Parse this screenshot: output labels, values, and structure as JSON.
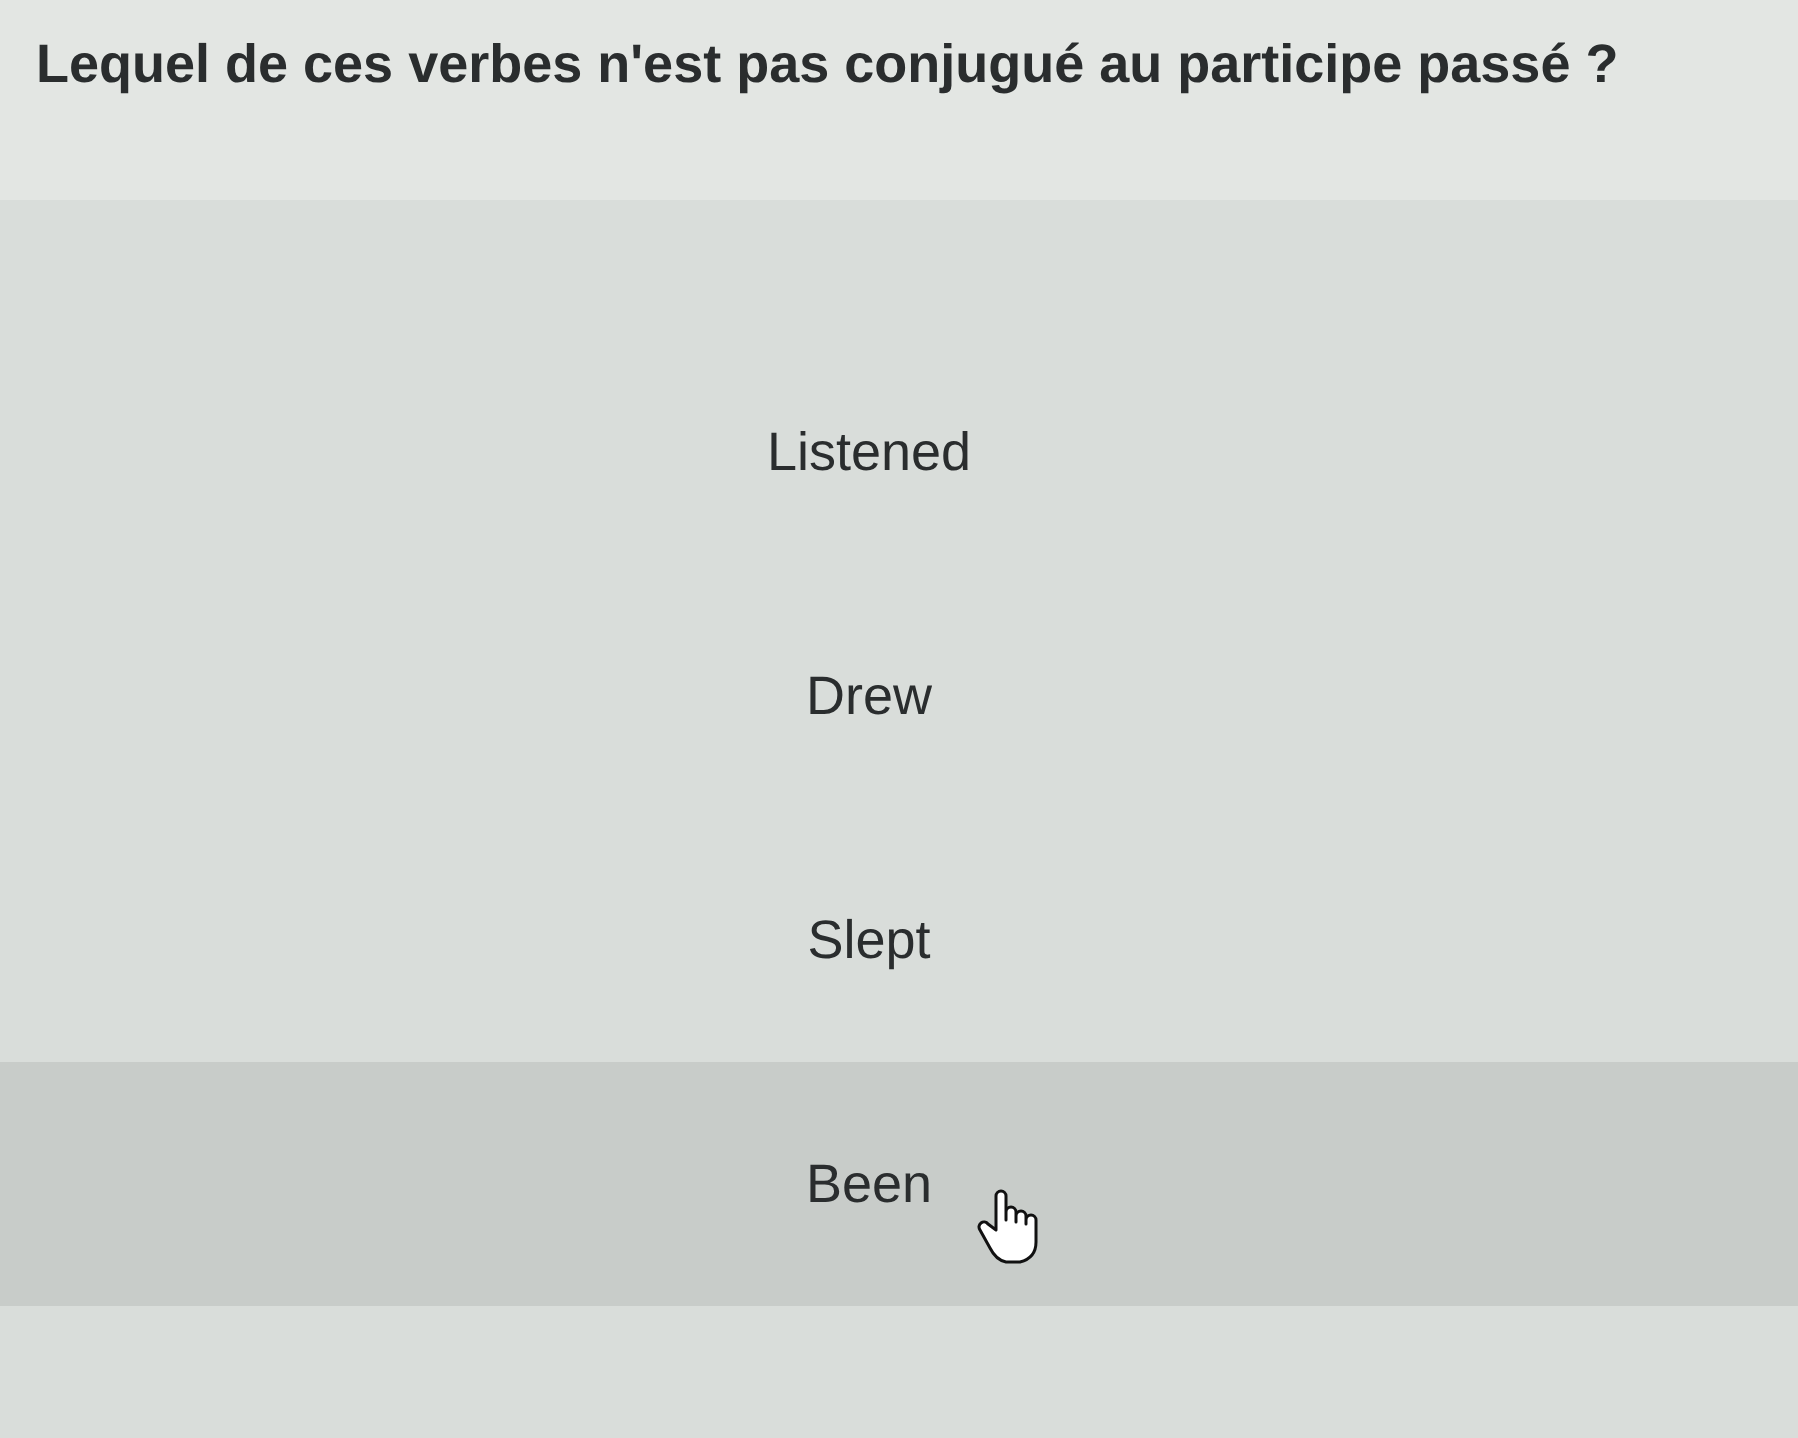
{
  "question": "Lequel de ces verbes n'est pas conjugué au participe passé ?",
  "options": [
    {
      "label": "Listened",
      "hovered": false
    },
    {
      "label": "Drew",
      "hovered": false
    },
    {
      "label": "Slept",
      "hovered": false
    },
    {
      "label": "Been",
      "hovered": true
    }
  ]
}
